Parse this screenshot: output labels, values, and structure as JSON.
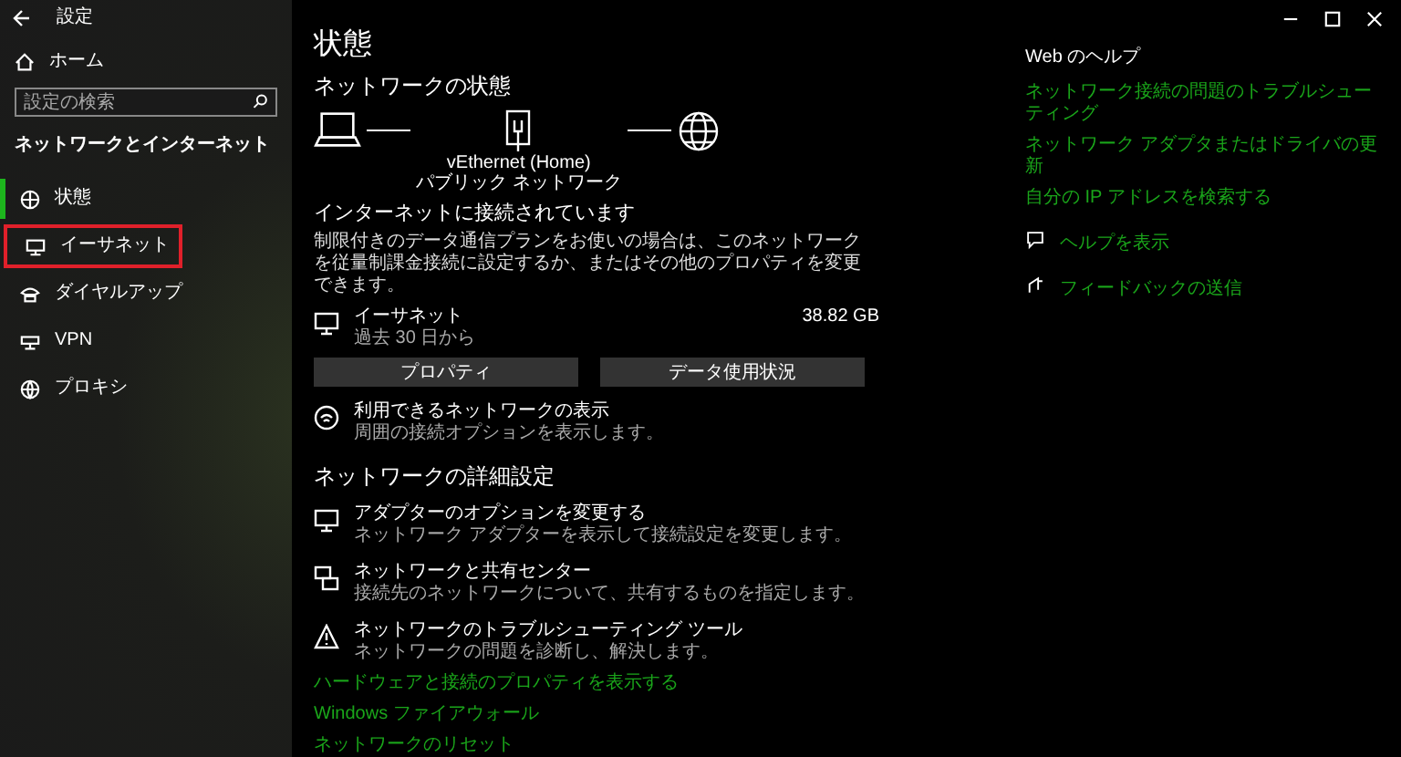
{
  "window": {
    "title": "設定"
  },
  "sidebar": {
    "home": "ホーム",
    "search_placeholder": "設定の検索",
    "section": "ネットワークとインターネット",
    "items": [
      {
        "label": "状態",
        "kind": "status",
        "selected": true,
        "annotated": false
      },
      {
        "label": "イーサネット",
        "kind": "ethernet",
        "selected": false,
        "annotated": true
      },
      {
        "label": "ダイヤルアップ",
        "kind": "dialup",
        "selected": false,
        "annotated": false
      },
      {
        "label": "VPN",
        "kind": "vpn",
        "selected": false,
        "annotated": false
      },
      {
        "label": "プロキシ",
        "kind": "proxy",
        "selected": false,
        "annotated": false
      }
    ]
  },
  "main": {
    "title": "状態",
    "status_heading": "ネットワークの状態",
    "diagram": {
      "adapter": "vEthernet (Home)",
      "network": "パブリック ネットワーク"
    },
    "connected_heading": "インターネットに接続されています",
    "connected_text": "制限付きのデータ通信プランをお使いの場合は、このネットワークを従量制課金接続に設定するか、またはその他のプロパティを変更できます。",
    "usage": {
      "name": "イーサネット",
      "period": "過去 30 日から",
      "amount": "38.82 GB"
    },
    "buttons": [
      "プロパティ",
      "データ使用状況"
    ],
    "available": {
      "title": "利用できるネットワークの表示",
      "desc": "周囲の接続オプションを表示します。"
    },
    "advanced_heading": "ネットワークの詳細設定",
    "advanced_items": [
      {
        "kind": "adapter",
        "title": "アダプターのオプションを変更する",
        "desc": "ネットワーク アダプターを表示して接続設定を変更します。"
      },
      {
        "kind": "sharing",
        "title": "ネットワークと共有センター",
        "desc": "接続先のネットワークについて、共有するものを指定します。"
      },
      {
        "kind": "troubleshoot",
        "title": "ネットワークのトラブルシューティング ツール",
        "desc": "ネットワークの問題を診断し、解決します。"
      }
    ],
    "links": [
      "ハードウェアと接続のプロパティを表示する",
      "Windows ファイアウォール",
      "ネットワークのリセット"
    ]
  },
  "help": {
    "heading": "Web のヘルプ",
    "links": [
      "ネットワーク接続の問題のトラブルシューティング",
      "ネットワーク アダプタまたはドライバの更新",
      "自分の IP アドレスを検索する"
    ],
    "actions": [
      {
        "kind": "help",
        "label": "ヘルプを表示"
      },
      {
        "kind": "feedback",
        "label": "フィードバックの送信"
      }
    ]
  }
}
